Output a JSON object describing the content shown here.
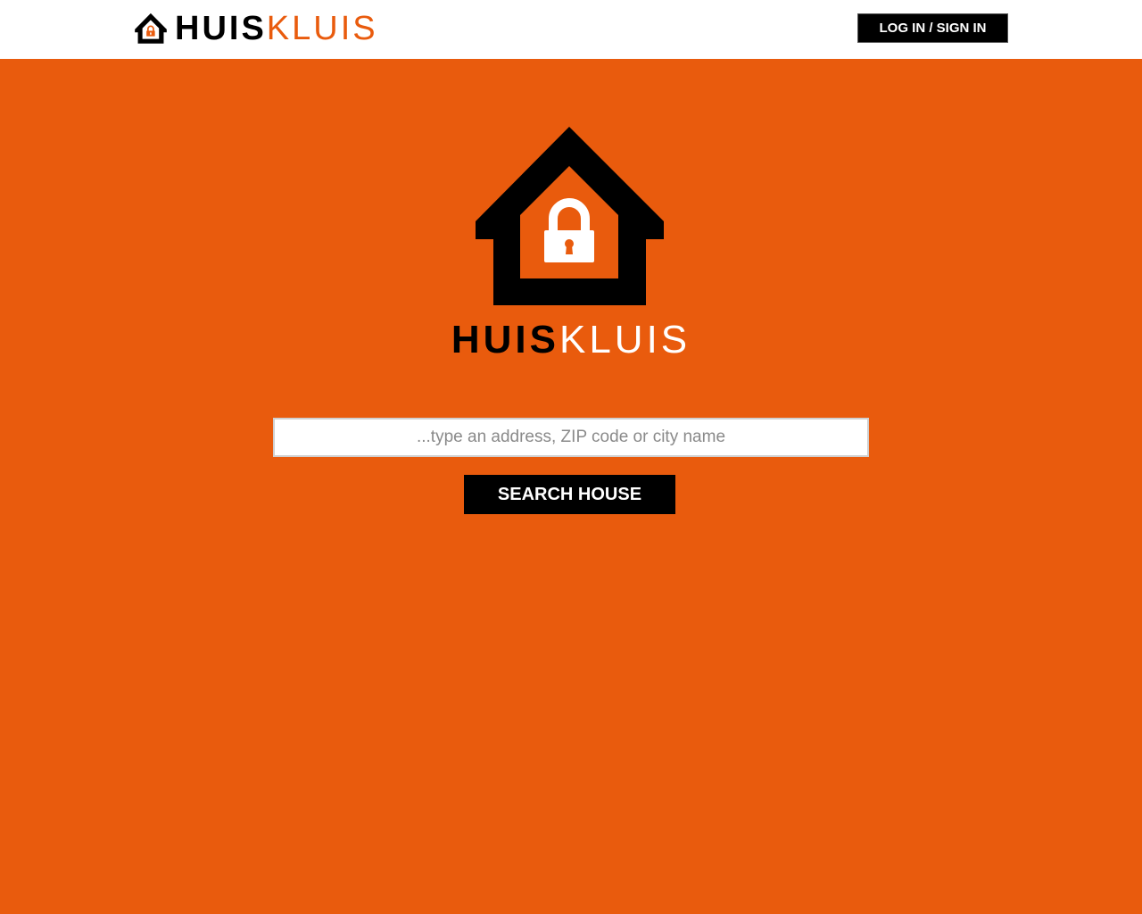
{
  "colors": {
    "accent": "#e95b0d",
    "dark": "#000000",
    "light": "#ffffff"
  },
  "header": {
    "logo_icon": "house-lock-icon",
    "brand_part1": "HUIS",
    "brand_part2": "KLUIS",
    "login_label": "LOG IN / SIGN IN"
  },
  "hero": {
    "logo_icon": "house-lock-icon",
    "brand_part1": "HUIS",
    "brand_part2": "KLUIS"
  },
  "search": {
    "placeholder": "...type an address, ZIP code or city name",
    "value": "",
    "button_label": "SEARCH HOUSE"
  }
}
